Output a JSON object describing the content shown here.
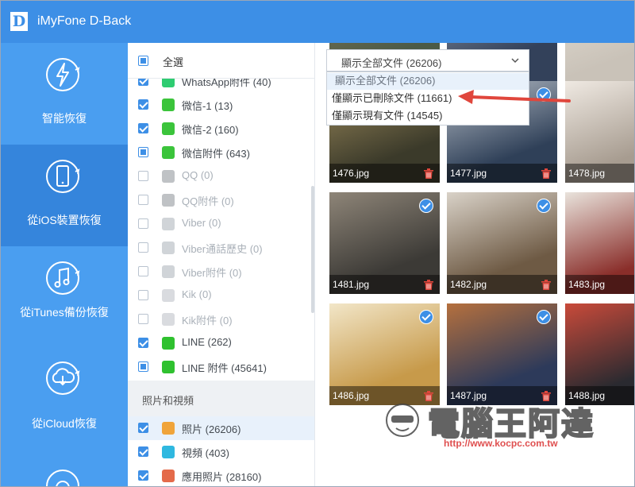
{
  "app": {
    "title": "iMyFone D-Back",
    "logo_letter": "D"
  },
  "sidebar": {
    "items": [
      {
        "label": "智能恢復",
        "icon": "lightning-refresh-icon",
        "active": false
      },
      {
        "label": "從iOS裝置恢復",
        "icon": "phone-refresh-icon",
        "active": true
      },
      {
        "label": "從iTunes備份恢復",
        "icon": "music-note-refresh-icon",
        "active": false
      },
      {
        "label": "從iCloud恢復",
        "icon": "cloud-download-icon",
        "active": false
      },
      {
        "label": "",
        "icon": "partial-icon",
        "active": false
      }
    ]
  },
  "filter": {
    "select_all_label": "全選",
    "rows": [
      {
        "label": "WhatsApp附件 (40)",
        "state": "checked",
        "icon": "whatsapp-icon"
      },
      {
        "label": "微信-1 (13)",
        "state": "checked",
        "icon": "wechat-icon"
      },
      {
        "label": "微信-2 (160)",
        "state": "checked",
        "icon": "wechat-icon"
      },
      {
        "label": "微信附件 (643)",
        "state": "partial",
        "icon": "wechat-icon"
      },
      {
        "label": "QQ (0)",
        "state": "unchecked",
        "icon": "qq-icon"
      },
      {
        "label": "QQ附件 (0)",
        "state": "unchecked",
        "icon": "qq-icon"
      },
      {
        "label": "Viber (0)",
        "state": "unchecked",
        "icon": "viber-icon"
      },
      {
        "label": "Viber通話歷史 (0)",
        "state": "unchecked",
        "icon": "viber-icon"
      },
      {
        "label": "Viber附件 (0)",
        "state": "unchecked",
        "icon": "viber-icon"
      },
      {
        "label": "Kik (0)",
        "state": "unchecked",
        "icon": "kik-icon"
      },
      {
        "label": "Kik附件 (0)",
        "state": "unchecked",
        "icon": "kik-icon"
      },
      {
        "label": "LINE (262)",
        "state": "checked",
        "icon": "line-icon"
      },
      {
        "label": "LINE 附件 (45641)",
        "state": "partial",
        "icon": "line-icon"
      }
    ],
    "section_label": "照片和視頻",
    "section_rows": [
      {
        "label": "照片 (26206)",
        "state": "checked",
        "icon": "photos-icon",
        "selected": true
      },
      {
        "label": "視頻 (403)",
        "state": "checked",
        "icon": "video-icon",
        "selected": false
      },
      {
        "label": "應用照片 (28160)",
        "state": "checked",
        "icon": "app-photos-icon",
        "selected": false
      }
    ]
  },
  "view_select": {
    "value": "顯示全部文件 (26206)",
    "options": [
      "顯示全部文件 (26206)",
      "僅顯示已刪除文件 (11661)",
      "僅顯示現有文件 (14545)"
    ]
  },
  "photos": [
    {
      "name": "",
      "checked": false,
      "deleted": false
    },
    {
      "name": "",
      "checked": true,
      "deleted": false
    },
    {
      "name": "",
      "checked": false,
      "deleted": false
    },
    {
      "name": "1476.jpg",
      "checked": false,
      "deleted": true
    },
    {
      "name": "1477.jpg",
      "checked": true,
      "deleted": true
    },
    {
      "name": "1478.jpg",
      "checked": false,
      "deleted": false
    },
    {
      "name": "1481.jpg",
      "checked": true,
      "deleted": true
    },
    {
      "name": "1482.jpg",
      "checked": true,
      "deleted": true
    },
    {
      "name": "1483.jpg",
      "checked": false,
      "deleted": false
    },
    {
      "name": "1486.jpg",
      "checked": true,
      "deleted": true
    },
    {
      "name": "1487.jpg",
      "checked": true,
      "deleted": true
    },
    {
      "name": "1488.jpg",
      "checked": false,
      "deleted": false
    }
  ],
  "watermark": {
    "text": "電腦王阿達",
    "url": "http://www.kocpc.com.tw"
  },
  "colors": {
    "accent": "#3d8fe6",
    "sidebar": "#4a9ef0",
    "sidebar_active": "#3585dc",
    "trash": "#e0463c",
    "arrow": "#e0463c"
  }
}
